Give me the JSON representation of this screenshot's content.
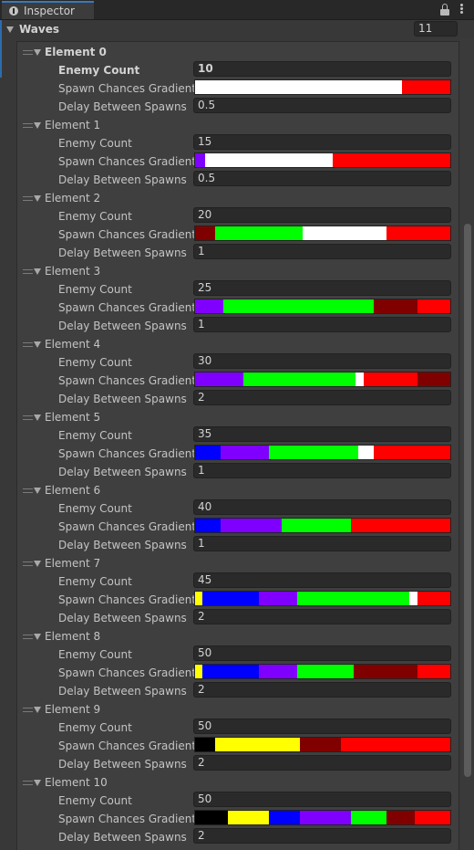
{
  "tab": {
    "label": "Inspector"
  },
  "waves": {
    "label": "Waves",
    "size": "11"
  },
  "labels": {
    "enemy_count": "Enemy Count",
    "gradient": "Spawn Chances Gradient",
    "delay": "Delay Between Spawns"
  },
  "elements": [
    {
      "title": "Element 0",
      "enemy_count": "10",
      "delay": "0.5",
      "gradient": [
        {
          "color": "#ffffff",
          "width": 0.81
        },
        {
          "color": "#ff0000",
          "width": 0.19
        }
      ]
    },
    {
      "title": "Element 1",
      "enemy_count": "15",
      "delay": "0.5",
      "gradient": [
        {
          "color": "#8000ff",
          "width": 0.04
        },
        {
          "color": "#ffffff",
          "width": 0.5
        },
        {
          "color": "#ff0000",
          "width": 0.46
        }
      ]
    },
    {
      "title": "Element 2",
      "enemy_count": "20",
      "delay": "1",
      "gradient": [
        {
          "color": "#800000",
          "width": 0.08
        },
        {
          "color": "#00ff00",
          "width": 0.34
        },
        {
          "color": "#ffffff",
          "width": 0.33
        },
        {
          "color": "#ff0000",
          "width": 0.25
        }
      ]
    },
    {
      "title": "Element 3",
      "enemy_count": "25",
      "delay": "1",
      "gradient": [
        {
          "color": "#8000ff",
          "width": 0.11
        },
        {
          "color": "#00ff00",
          "width": 0.59
        },
        {
          "color": "#800000",
          "width": 0.17
        },
        {
          "color": "#ff0000",
          "width": 0.13
        }
      ]
    },
    {
      "title": "Element 4",
      "enemy_count": "30",
      "delay": "2",
      "gradient": [
        {
          "color": "#8000ff",
          "width": 0.19
        },
        {
          "color": "#00ff00",
          "width": 0.44
        },
        {
          "color": "#ffffff",
          "width": 0.03
        },
        {
          "color": "#ff0000",
          "width": 0.21
        },
        {
          "color": "#800000",
          "width": 0.13
        }
      ]
    },
    {
      "title": "Element 5",
      "enemy_count": "35",
      "delay": "1",
      "gradient": [
        {
          "color": "#0000ff",
          "width": 0.1
        },
        {
          "color": "#8000ff",
          "width": 0.19
        },
        {
          "color": "#00ff00",
          "width": 0.35
        },
        {
          "color": "#ffffff",
          "width": 0.06
        },
        {
          "color": "#ff0000",
          "width": 0.3
        }
      ]
    },
    {
      "title": "Element 6",
      "enemy_count": "40",
      "delay": "1",
      "gradient": [
        {
          "color": "#0000ff",
          "width": 0.1
        },
        {
          "color": "#8000ff",
          "width": 0.24
        },
        {
          "color": "#00ff00",
          "width": 0.27
        },
        {
          "color": "#ff0000",
          "width": 0.39
        }
      ]
    },
    {
      "title": "Element 7",
      "enemy_count": "45",
      "delay": "2",
      "gradient": [
        {
          "color": "#ffff00",
          "width": 0.03
        },
        {
          "color": "#0000ff",
          "width": 0.22
        },
        {
          "color": "#8000ff",
          "width": 0.15
        },
        {
          "color": "#00ff00",
          "width": 0.44
        },
        {
          "color": "#ffffff",
          "width": 0.03
        },
        {
          "color": "#ff0000",
          "width": 0.13
        }
      ]
    },
    {
      "title": "Element 8",
      "enemy_count": "50",
      "delay": "2",
      "gradient": [
        {
          "color": "#ffff00",
          "width": 0.03
        },
        {
          "color": "#0000ff",
          "width": 0.22
        },
        {
          "color": "#8000ff",
          "width": 0.15
        },
        {
          "color": "#00ff00",
          "width": 0.22
        },
        {
          "color": "#800000",
          "width": 0.25
        },
        {
          "color": "#ff0000",
          "width": 0.13
        }
      ]
    },
    {
      "title": "Element 9",
      "enemy_count": "50",
      "delay": "2",
      "gradient": [
        {
          "color": "#000000",
          "width": 0.08
        },
        {
          "color": "#ffff00",
          "width": 0.33
        },
        {
          "color": "#800000",
          "width": 0.16
        },
        {
          "color": "#ff0000",
          "width": 0.43
        }
      ]
    },
    {
      "title": "Element 10",
      "enemy_count": "50",
      "delay": "2",
      "gradient": [
        {
          "color": "#000000",
          "width": 0.13
        },
        {
          "color": "#ffff00",
          "width": 0.16
        },
        {
          "color": "#0000ff",
          "width": 0.12
        },
        {
          "color": "#8000ff",
          "width": 0.2
        },
        {
          "color": "#00ff00",
          "width": 0.14
        },
        {
          "color": "#800000",
          "width": 0.11
        },
        {
          "color": "#ff0000",
          "width": 0.14
        }
      ]
    }
  ]
}
